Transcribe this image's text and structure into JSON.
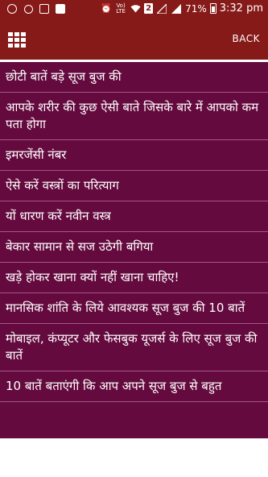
{
  "status_bar": {
    "battery_percent": "71%",
    "time": "3:32 pm",
    "sim_label": "2",
    "network_label": "Vo) LTE"
  },
  "app_bar": {
    "back_label": "BACK"
  },
  "list": {
    "items": [
      "छोटी बातें बड़े सूज बुज की",
      "आपके शरीर की कुछ ऐसी बाते जिसके बारे में आपको कम पता होगा",
      "इमरजेंसी नंबर",
      "ऐसे करें वस्त्रों का परित्याग",
      "यों धारण करें नवीन वस्त्र",
      "बेकार सामान से सज उठेगी बगिया",
      "खड़े होकर खाना क्यों नहीं खाना चाहिए!",
      "मानसिक शांति के लिये आवश्यक सूज बुज की 10 बातें",
      "मोबाइल, कंप्यूटर और फेसबुक यूजर्स के लिए सूज बुज की बातें",
      "10 बातें बताएंगी कि आप अपने सूज बुज से बहुत"
    ]
  }
}
